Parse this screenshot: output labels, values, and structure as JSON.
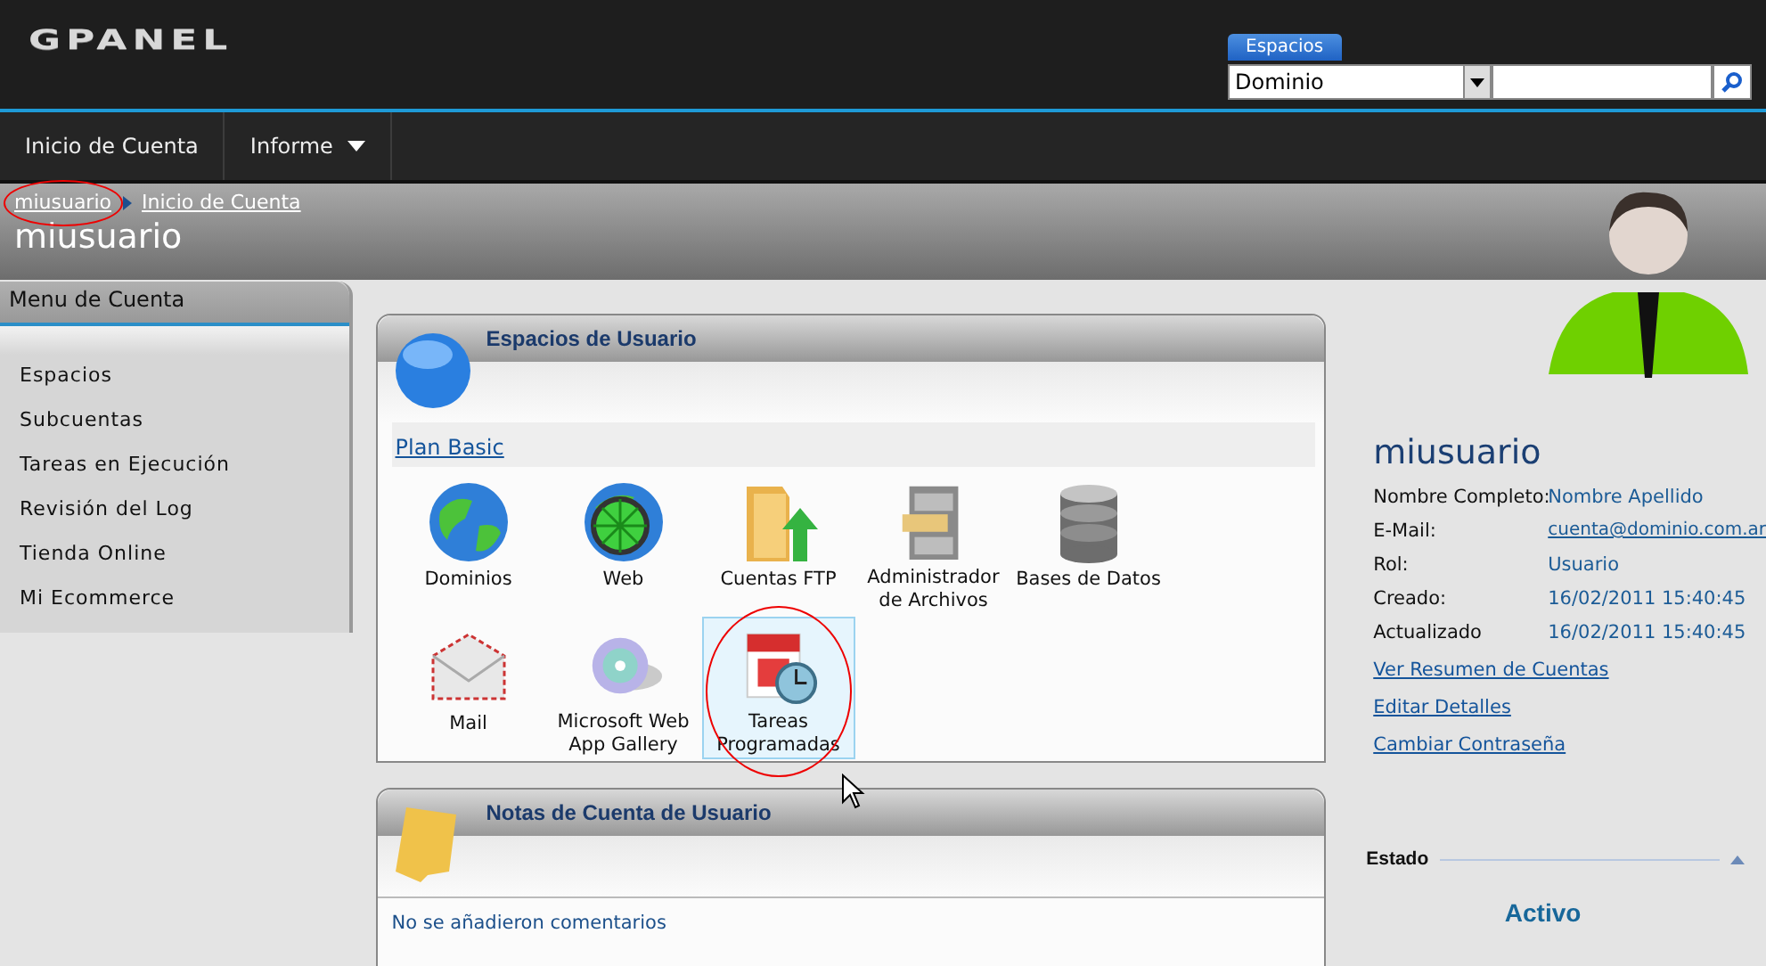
{
  "logo": "GPANEL",
  "search": {
    "tab": "Espacios",
    "dropdown_value": "Dominio"
  },
  "nav": [
    {
      "label": "Inicio de Cuenta",
      "has_menu": false
    },
    {
      "label": "Informe",
      "has_menu": true
    }
  ],
  "breadcrumb": [
    {
      "label": "miusuario",
      "circled": true
    },
    {
      "label": "Inicio de Cuenta",
      "circled": false
    }
  ],
  "page_title": "miusuario",
  "sidebar": {
    "title": "Menu de Cuenta",
    "items": [
      "Espacios",
      "Subcuentas",
      "Tareas en Ejecución",
      "Revisión del Log",
      "Tienda Online",
      "Mi Ecommerce"
    ]
  },
  "spaces_panel": {
    "title": "Espacios de Usuario",
    "plan": "Plan Basic",
    "items": [
      {
        "label": "Dominios",
        "kind": "globe",
        "selected": false,
        "circled": false
      },
      {
        "label": "Web",
        "kind": "globe-wheel",
        "selected": false,
        "circled": false
      },
      {
        "label": "Cuentas FTP",
        "kind": "folder",
        "selected": false,
        "circled": false
      },
      {
        "label": "Administrador de Archivos",
        "kind": "cabinet",
        "selected": false,
        "circled": false
      },
      {
        "label": "Bases de Datos",
        "kind": "database",
        "selected": false,
        "circled": false
      },
      {
        "label": "Mail",
        "kind": "envelope",
        "selected": false,
        "circled": false
      },
      {
        "label": "Microsoft Web App Gallery",
        "kind": "disc",
        "selected": false,
        "circled": false
      },
      {
        "label": "Tareas Programadas",
        "kind": "calendar",
        "selected": true,
        "circled": true
      }
    ]
  },
  "notes_panel": {
    "title": "Notas de Cuenta de Usuario",
    "empty_text": "No se añadieron comentarios"
  },
  "profile": {
    "name": "miusuario",
    "fields": [
      {
        "label": "Nombre Completo:",
        "value": "Nombre Apellido",
        "link": false
      },
      {
        "label": "E-Mail:",
        "value": "cuenta@dominio.com.ar",
        "link": true
      },
      {
        "label": "Rol:",
        "value": "Usuario",
        "link": false
      },
      {
        "label": "Creado:",
        "value": "16/02/2011 15:40:45",
        "link": false
      },
      {
        "label": "Actualizado",
        "value": "16/02/2011 15:40:45",
        "link": false
      }
    ],
    "links": [
      "Ver Resumen de Cuentas",
      "Editar Detalles",
      "Cambiar Contraseña"
    ]
  },
  "status": {
    "title": "Estado",
    "value": "Activo"
  }
}
